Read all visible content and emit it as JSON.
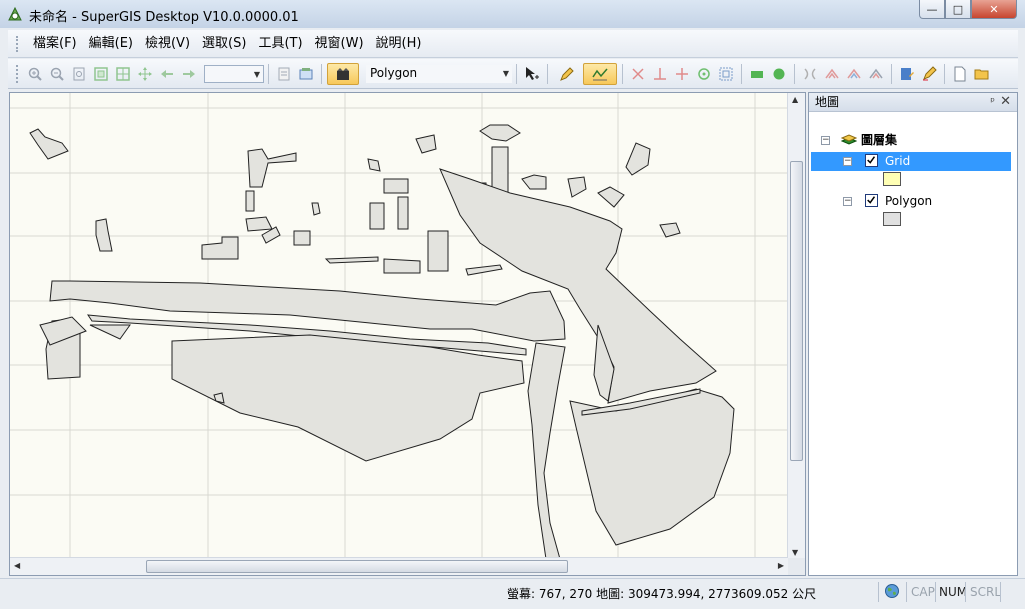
{
  "window": {
    "title": "未命名 - SuperGIS Desktop V10.0.0000.01",
    "minimize_glyph": "—",
    "maximize_glyph": "□",
    "close_glyph": "✕"
  },
  "menu": {
    "items": [
      "檔案(F)",
      "編輯(E)",
      "檢視(V)",
      "選取(S)",
      "工具(T)",
      "視窗(W)",
      "說明(H)"
    ]
  },
  "toolbar": {
    "scale_value": "",
    "layer_select": "Polygon",
    "icons": [
      "zoom-in-icon",
      "zoom-out-icon",
      "fixed-zoom-icon",
      "full-extent-icon",
      "zoom-layer-icon",
      "pan-icon",
      "back-extent-icon",
      "forward-extent-icon",
      "identify-icon",
      "layer-icon",
      "editor-icon",
      "select-feature-icon",
      "pencil-icon",
      "snap-icon",
      "delete-vertex-icon",
      "perpendicular-icon",
      "cross-icon",
      "rotate-icon",
      "scale-icon",
      "rectangle-icon",
      "circle-icon",
      "split-icon",
      "merge-icon",
      "union-icon",
      "intersect-icon",
      "save-edits-icon",
      "attribute-icon",
      "new-file-icon",
      "open-file-icon"
    ]
  },
  "panel": {
    "title": "地圖",
    "root_label": "圖層集",
    "layers": [
      {
        "name": "Grid",
        "checked": true,
        "swatch": "#ffffb4"
      },
      {
        "name": "Polygon",
        "checked": true,
        "swatch": "#e0e0e0"
      }
    ]
  },
  "status": {
    "coords": "螢幕: 767, 270  地圖: 309473.994, 2773609.052 公尺",
    "keys": [
      {
        "label": "CAP",
        "active": false
      },
      {
        "label": "NUM",
        "active": true
      },
      {
        "label": "SCRL",
        "active": false
      }
    ]
  },
  "colors": {
    "map_background": "#fbfbf4",
    "polygon_fill": "#e3e3de",
    "polygon_stroke": "#222222",
    "grid_line": "#d8d8d2",
    "selection": "#3399ff"
  }
}
